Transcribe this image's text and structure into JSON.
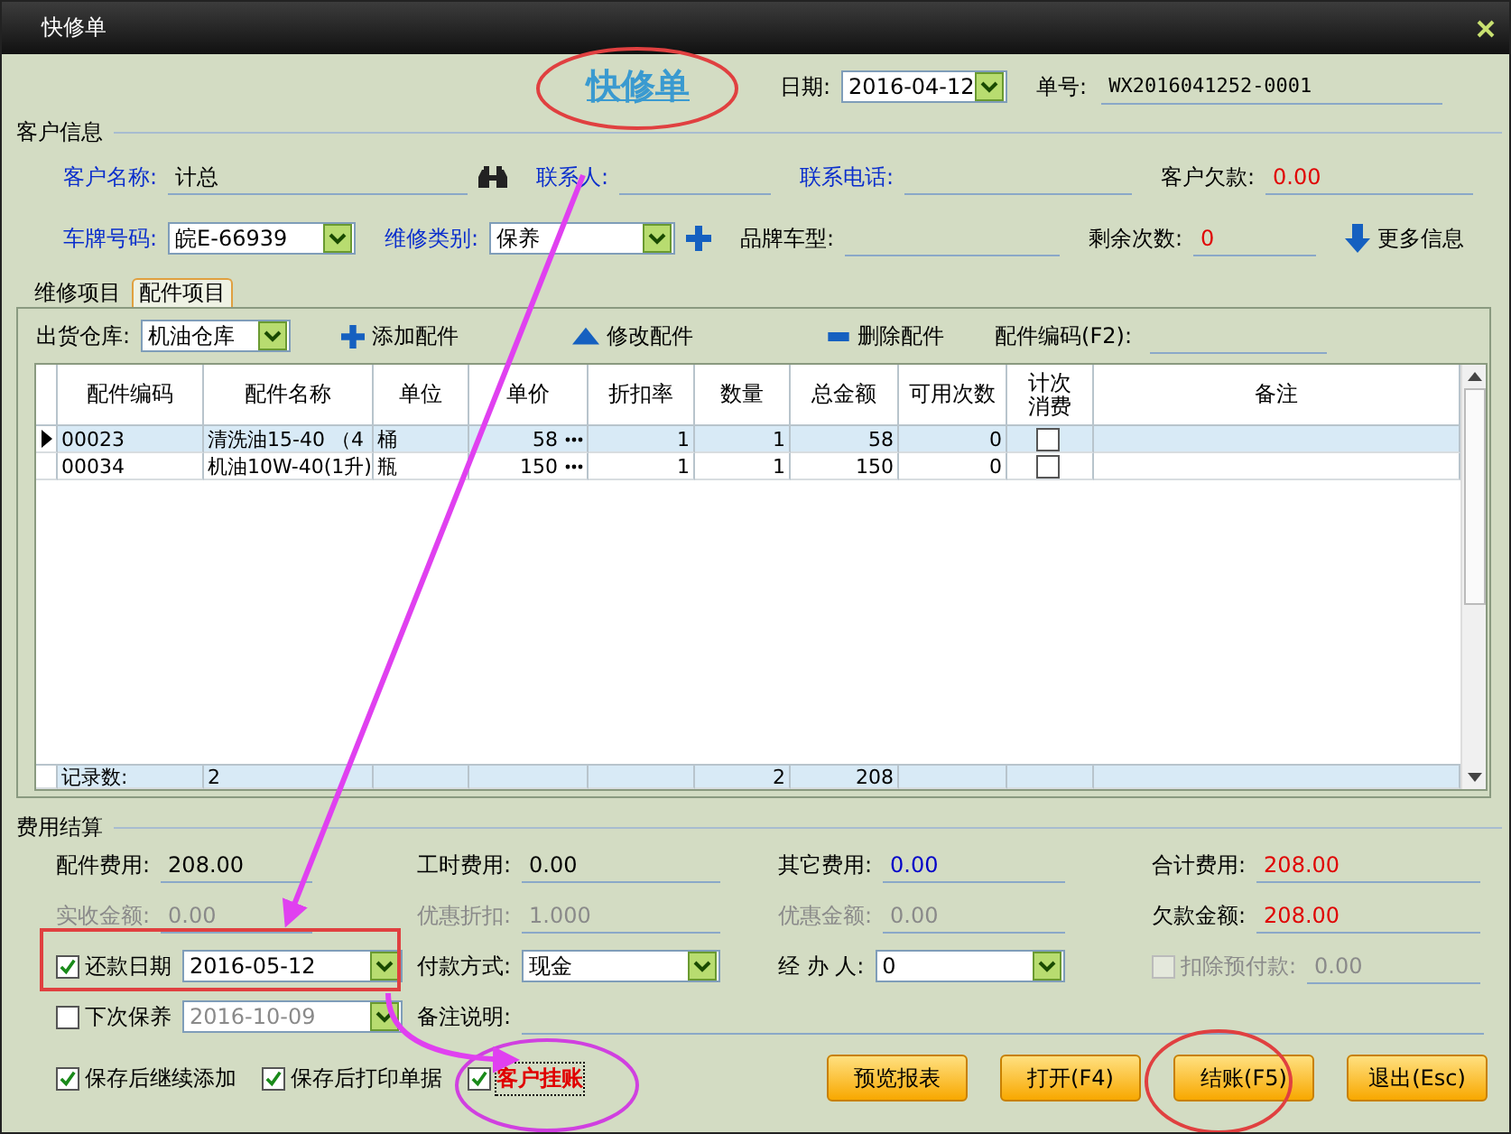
{
  "window": {
    "title": "快修单"
  },
  "header": {
    "title": "快修单",
    "date_label": "日期:",
    "date": "2016-04-12",
    "number_label": "单号:",
    "number": "WX2016041252-0001"
  },
  "customer": {
    "title": "客户信息",
    "rows": [
      [
        {
          "kind": "lookup",
          "label": "客户名称:",
          "value": "计总",
          "highlighted": true
        },
        {
          "kind": "field",
          "label": "联系人:",
          "highlighted": true
        },
        {
          "kind": "field",
          "label": "联系电话:",
          "highlighted": true
        },
        {
          "kind": "field",
          "label": "客户欠款:",
          "value": "0.00",
          "color": "#e00000",
          "highlighted": false
        }
      ],
      [
        {
          "kind": "select",
          "label": "车牌号码:",
          "value": "皖E-66939",
          "highlighted": true
        },
        {
          "kind": "select-add",
          "label": "维修类别:",
          "value": "保养",
          "highlighted": true
        },
        {
          "kind": "field",
          "label": "品牌车型:",
          "highlighted": false
        },
        {
          "kind": "field",
          "label": "剩余次数:",
          "value": "0",
          "color": "#e00000",
          "highlighted": false
        },
        {
          "kind": "link",
          "label": "更多信息",
          "highlighted": false
        }
      ]
    ]
  },
  "tabs": [
    {
      "label": "维修项目",
      "selected": false
    },
    {
      "label": "配件项目",
      "selected": true
    }
  ],
  "parts": {
    "toolbar": {
      "warehouse_label": "出货仓库:",
      "warehouse": "机油仓库",
      "add": "添加配件",
      "edit": "修改配件",
      "delete": "删除配件",
      "code_label": "配件编码(F2):"
    },
    "columns": [
      "配件编码",
      "配件名称",
      "单位",
      "单价",
      "折扣率",
      "数量",
      "总金额",
      "可用次数",
      "计次消费",
      "备注"
    ],
    "rows": [
      {
        "selected": true,
        "counted": false,
        "cells": [
          "00023",
          "清洗油15-40 （4",
          "桶",
          "58",
          "1",
          "1",
          "58",
          "0"
        ]
      },
      {
        "selected": false,
        "counted": false,
        "cells": [
          "00034",
          "机油10W-40(1升)",
          "瓶",
          "150",
          "1",
          "1",
          "150",
          "0"
        ]
      }
    ],
    "footer": {
      "label": "记录数:",
      "count": "2",
      "quantity": "2",
      "total": "208"
    }
  },
  "costs": {
    "title": "费用结算",
    "rows": [
      [
        {
          "kind": "field",
          "label": "配件费用:",
          "value": "208.00",
          "disabled": false
        },
        {
          "kind": "field",
          "label": "工时费用:",
          "value": "0.00",
          "disabled": false
        },
        {
          "kind": "field",
          "label": "其它费用:",
          "value": "0.00",
          "color": "#0000c8",
          "disabled": false
        },
        {
          "kind": "field",
          "label": "合计费用:",
          "value": "208.00",
          "color": "#e00000",
          "disabled": false
        }
      ],
      [
        {
          "kind": "field",
          "label": "实收金额:",
          "value": "0.00",
          "disabled": true
        },
        {
          "kind": "field",
          "label": "优惠折扣:",
          "value": "1.000",
          "disabled": true
        },
        {
          "kind": "field",
          "label": "优惠金额:",
          "value": "0.00",
          "disabled": true
        },
        {
          "kind": "field",
          "label": "欠款金额:",
          "value": "208.00",
          "color": "#e00000",
          "disabled": false
        }
      ],
      [
        {
          "kind": "check-select",
          "label": "还款日期",
          "value": "2016-05-12",
          "checked": true,
          "disabled": false
        },
        {
          "kind": "select",
          "label": "付款方式:",
          "value": "现金",
          "disabled": false
        },
        {
          "kind": "select",
          "label": "经 办 人:",
          "value": "0",
          "disabled": false
        },
        {
          "kind": "check-field",
          "label": "扣除预付款:",
          "value": "0.00",
          "checked": false,
          "disabled": true
        }
      ],
      [
        {
          "kind": "check-select",
          "label": "下次保养",
          "value": "2016-10-09",
          "checked": false,
          "disabled": true
        },
        {
          "kind": "wide-field",
          "label": "备注说明:",
          "disabled": false
        }
      ]
    ]
  },
  "options": [
    {
      "label": "保存后继续添加",
      "checked": true,
      "emphasis": false
    },
    {
      "label": "保存后打印单据",
      "checked": true,
      "emphasis": false
    },
    {
      "label": "客户挂账",
      "checked": true,
      "emphasis": true
    }
  ],
  "buttons": [
    "预览报表",
    "打开(F4)",
    "结账(F5)",
    "退出(Esc)"
  ]
}
